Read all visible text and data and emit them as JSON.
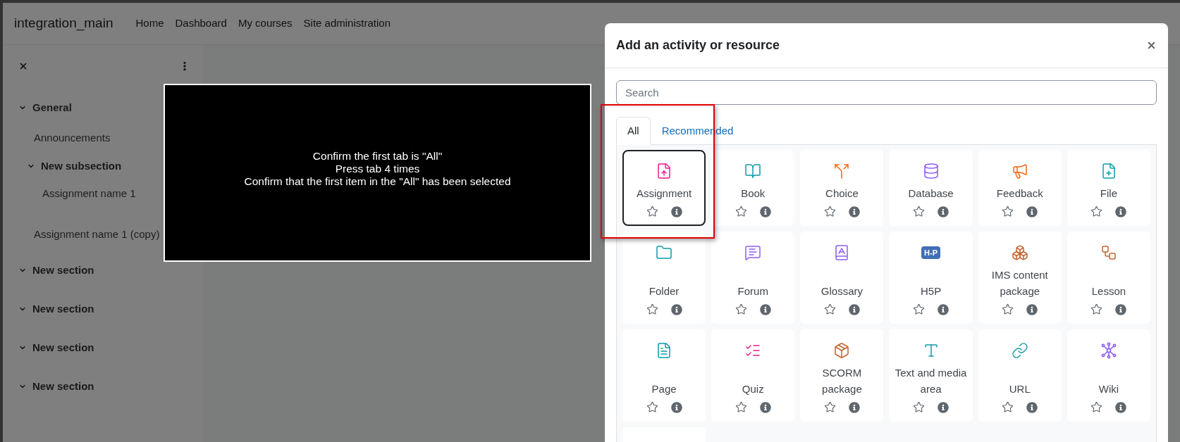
{
  "navbar": {
    "site_name": "integration_main",
    "links": [
      "Home",
      "Dashboard",
      "My courses",
      "Site administration"
    ]
  },
  "course_index": {
    "items": [
      {
        "kind": "section",
        "label": "General",
        "expanded": true,
        "children": [
          {
            "kind": "activity",
            "label": "Announcements"
          },
          {
            "kind": "section",
            "label": "New subsection",
            "expanded": true,
            "children": [
              {
                "kind": "activity",
                "label": "Assignment name 1"
              }
            ]
          },
          {
            "kind": "activity",
            "label": "Assignment name 1 (copy)"
          }
        ]
      },
      {
        "kind": "section",
        "label": "New section",
        "expanded": true
      },
      {
        "kind": "section",
        "label": "New section",
        "expanded": true
      },
      {
        "kind": "section",
        "label": "New section",
        "expanded": true
      },
      {
        "kind": "section",
        "label": "New section",
        "expanded": true
      }
    ]
  },
  "test_instructions": [
    "Confirm the first tab is \"All\"",
    "Press tab 4 times",
    "Confirm that the first item in the \"All\" has been selected"
  ],
  "modal": {
    "title": "Add an activity or resource",
    "search": {
      "placeholder": "Search"
    },
    "tabs": [
      {
        "label": "All",
        "selected": true
      },
      {
        "label": "Recommended",
        "selected": false
      }
    ],
    "activities": [
      {
        "name": "Assignment",
        "selected": true
      },
      {
        "name": "Book",
        "selected": false
      },
      {
        "name": "Choice",
        "selected": false
      },
      {
        "name": "Database",
        "selected": false
      },
      {
        "name": "Feedback",
        "selected": false
      },
      {
        "name": "File",
        "selected": false
      },
      {
        "name": "Folder",
        "selected": false
      },
      {
        "name": "Forum",
        "selected": false
      },
      {
        "name": "Glossary",
        "selected": false
      },
      {
        "name": "H5P",
        "selected": false,
        "logo_text": "H-P"
      },
      {
        "name": "IMS content package",
        "selected": false
      },
      {
        "name": "Lesson",
        "selected": false
      },
      {
        "name": "Page",
        "selected": false
      },
      {
        "name": "Quiz",
        "selected": false
      },
      {
        "name": "SCORM package",
        "selected": false
      },
      {
        "name": "Text and media area",
        "selected": false
      },
      {
        "name": "URL",
        "selected": false
      },
      {
        "name": "Wiki",
        "selected": false
      },
      {
        "selected": false
      }
    ]
  }
}
